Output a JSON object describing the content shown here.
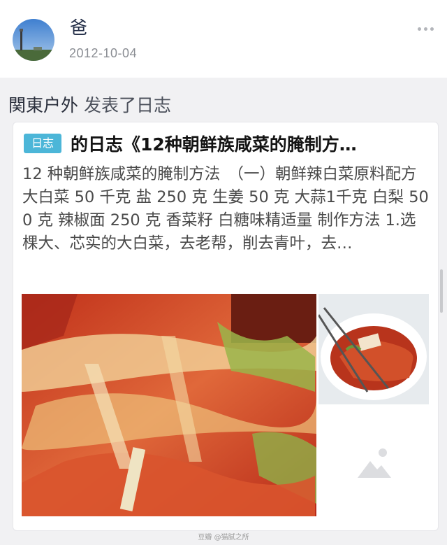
{
  "post": {
    "username": "爸",
    "date": "2012-10-04",
    "author": "関東户外",
    "action": "发表了日志"
  },
  "card": {
    "tag": "日志",
    "title": "的日志《12种朝鲜族咸菜的腌制方…",
    "excerpt": "12 种朝鲜族咸菜的腌制方法　（一）朝鲜辣白菜原料配方 大白菜 50 千克 盐 250 克 生姜 50 克 大蒜1千克 白梨 500 克 辣椒面 250 克 香菜籽 白糖味精适量 制作方法 1.选棵大、芯实的大白菜，去老帮，削去青叶，去…"
  },
  "icons": {
    "more": "more-dots-icon",
    "image_placeholder": "image-placeholder-icon"
  },
  "colors": {
    "tag_bg": "#4cb6d8",
    "page_bg": "#f1f1f3"
  },
  "watermark": "豆瓣 @猫腻之所"
}
